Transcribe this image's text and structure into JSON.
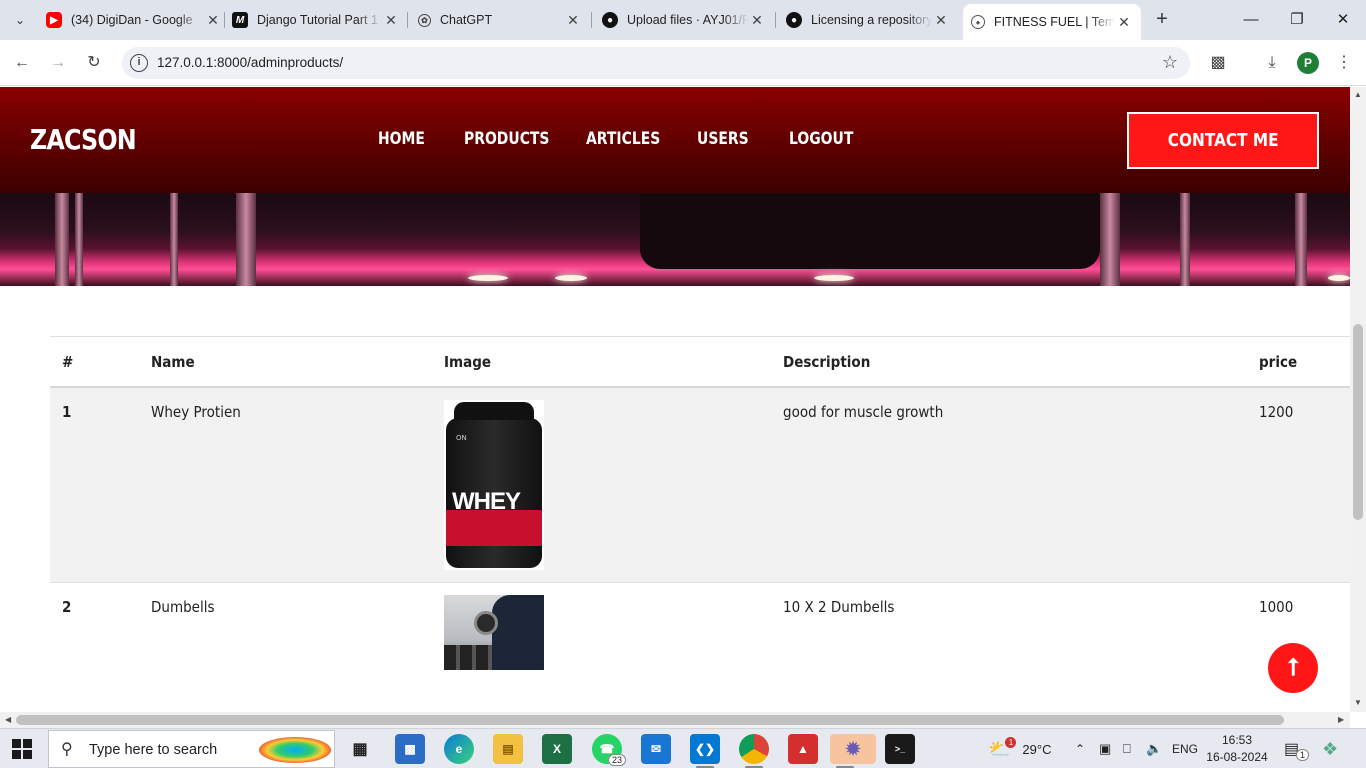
{
  "browser": {
    "tabs": [
      {
        "title": "(34) DigiDan - Google",
        "icon": "youtube-icon",
        "active": false
      },
      {
        "title": "Django Tutorial Part 1",
        "icon": "medium-icon",
        "active": false
      },
      {
        "title": "ChatGPT",
        "icon": "chatgpt-icon",
        "active": false
      },
      {
        "title": "Upload files · AYJ01/F",
        "icon": "github-icon",
        "active": false
      },
      {
        "title": "Licensing a repository",
        "icon": "github-icon",
        "active": false
      },
      {
        "title": "FITNESS FUEL | Templ",
        "icon": "globe-icon",
        "active": true
      }
    ],
    "url": "127.0.0.1:8000/adminproducts/",
    "profile_initial": "P"
  },
  "site": {
    "logo": "ZACSON",
    "nav": [
      "HOME",
      "PRODUCTS",
      "ARTICLES",
      "USERS",
      "LOGOUT"
    ],
    "contact_label": "CONTACT ME",
    "back_to_top_icon": "arrow-up-icon"
  },
  "products_table": {
    "columns": [
      "#",
      "Name",
      "Image",
      "Description",
      "price"
    ],
    "rows": [
      {
        "id": "1",
        "name": "Whey Protien",
        "image": "whey-protein-tub",
        "image_text": "WHEY",
        "description": "good for muscle growth",
        "price": "1200"
      },
      {
        "id": "2",
        "name": "Dumbells",
        "image": "dumbbell-photo",
        "description": "10 X 2 Dumbells",
        "price": "1000"
      }
    ]
  },
  "taskbar": {
    "search_placeholder": "Type here to search",
    "whatsapp_badge": "23",
    "weather": "29°C",
    "weather_badge": "1",
    "language": "ENG",
    "time": "16:53",
    "date": "16-08-2024",
    "notification_badge": "1"
  },
  "colors": {
    "header_top": "#8a0000",
    "header_bottom": "#3b0000",
    "accent_red": "#ff1717",
    "row_alt": "#f2f2f2"
  }
}
